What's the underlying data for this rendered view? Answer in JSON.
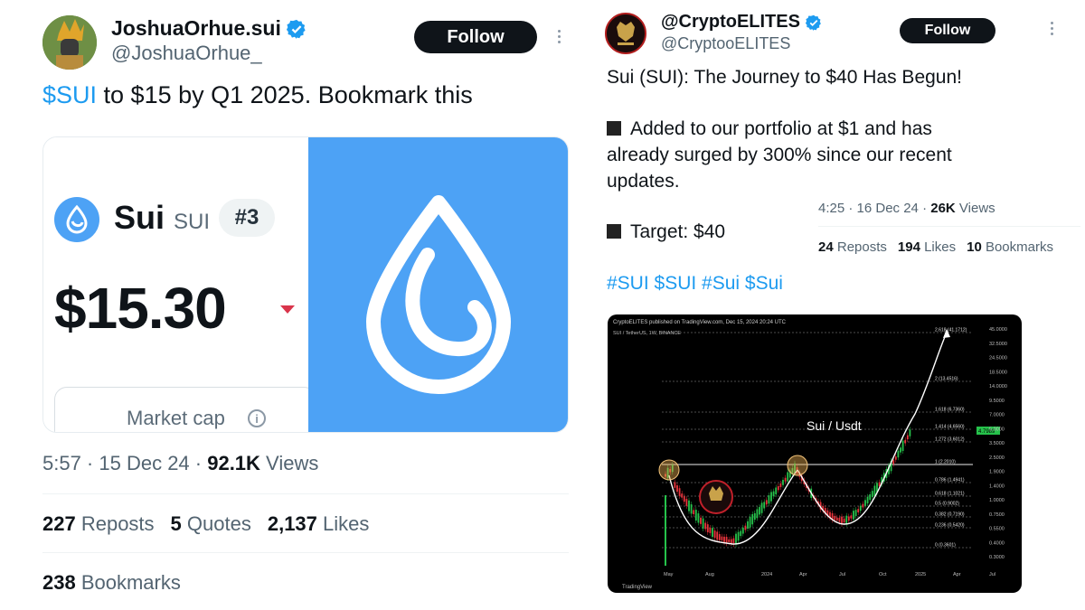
{
  "left_tweet": {
    "display_name": "JoshuaOrhue.sui",
    "handle": "@JoshuaOrhue_",
    "follow_label": "Follow",
    "text_tag": "$SUI",
    "text_rest": " to $15 by Q1 2025. Bookmark this",
    "card": {
      "coin_name": "Sui",
      "coin_symbol": "SUI",
      "rank": "#3",
      "price": "$15.30",
      "market_cap_label": "Market cap",
      "info_glyph": "i"
    },
    "time": "5:57 · 15 Dec 24 · ",
    "views_count": "92.1K",
    "views_label": " Views",
    "reposts_count": "227",
    "reposts_label": " Reposts",
    "quotes_count": "5",
    "quotes_label": " Quotes",
    "likes_count": "2,137",
    "likes_label": " Likes",
    "bookmarks_count": "238",
    "bookmarks_label": " Bookmarks"
  },
  "right_tweet": {
    "display_name": "@CryptoELITES",
    "handle": "@CryptooELITES",
    "follow_label": "Follow",
    "line1": "Sui (SUI): The Journey to $40 Has Begun!",
    "line2": "Added to our portfolio at $1 and has",
    "line3": "already surged by 300% since our recent",
    "line4": "updates.",
    "line5": "Target: $40",
    "time": "4:25 · 16 Dec 24 · ",
    "views_count": "26K",
    "views_label": " Views",
    "reposts_count": "24",
    "reposts_label": " Reposts",
    "likes_count": "194",
    "likes_label": " Likes",
    "bookmarks_count": "10",
    "bookmarks_label": " Bookmarks",
    "hashtags": "#SUI $SUI #Sui $Sui"
  },
  "chart_image": {
    "header": "CryptoELITES published on TradingView.com, Dec 15, 2024 20:24 UTC",
    "ticker_line": "SUI / TetherUS, 1W, BINANCE",
    "annotation": "Sui / Usdt",
    "watermark": "TradingView",
    "x_ticks": [
      "May",
      "Aug",
      "2024",
      "Apr",
      "Jul",
      "Oct",
      "2025",
      "Apr",
      "Jul"
    ],
    "y_ticks": [
      "45.0000",
      "32.5000",
      "24.5000",
      "18.5000",
      "14.0000",
      "9.5000",
      "7.0000",
      "5.0000",
      "3.5000",
      "2.5000",
      "1.9000",
      "1.4000",
      "1.0000",
      "0.7500",
      "0.5500",
      "0.4000",
      "0.3000"
    ],
    "price_tag": "4.7989",
    "fib_levels": [
      "2.618 (41.1712)",
      "2 (13.4516)",
      "1.618 (6.7360)",
      "1.414 (4.6560)",
      "1.272 (3.6012)",
      "1 (2.2010)",
      "0.786 (1.4941)",
      "0.618 (1.1021)",
      "0.5 (0.9002)",
      "0.382 (0.7190)",
      "0.236 (0.5420)",
      "0 (0.3601)"
    ],
    "colors": {
      "up": "#26c24b",
      "down": "#e8333b",
      "background": "#000000",
      "fib_line": "#bdbdbd"
    }
  }
}
